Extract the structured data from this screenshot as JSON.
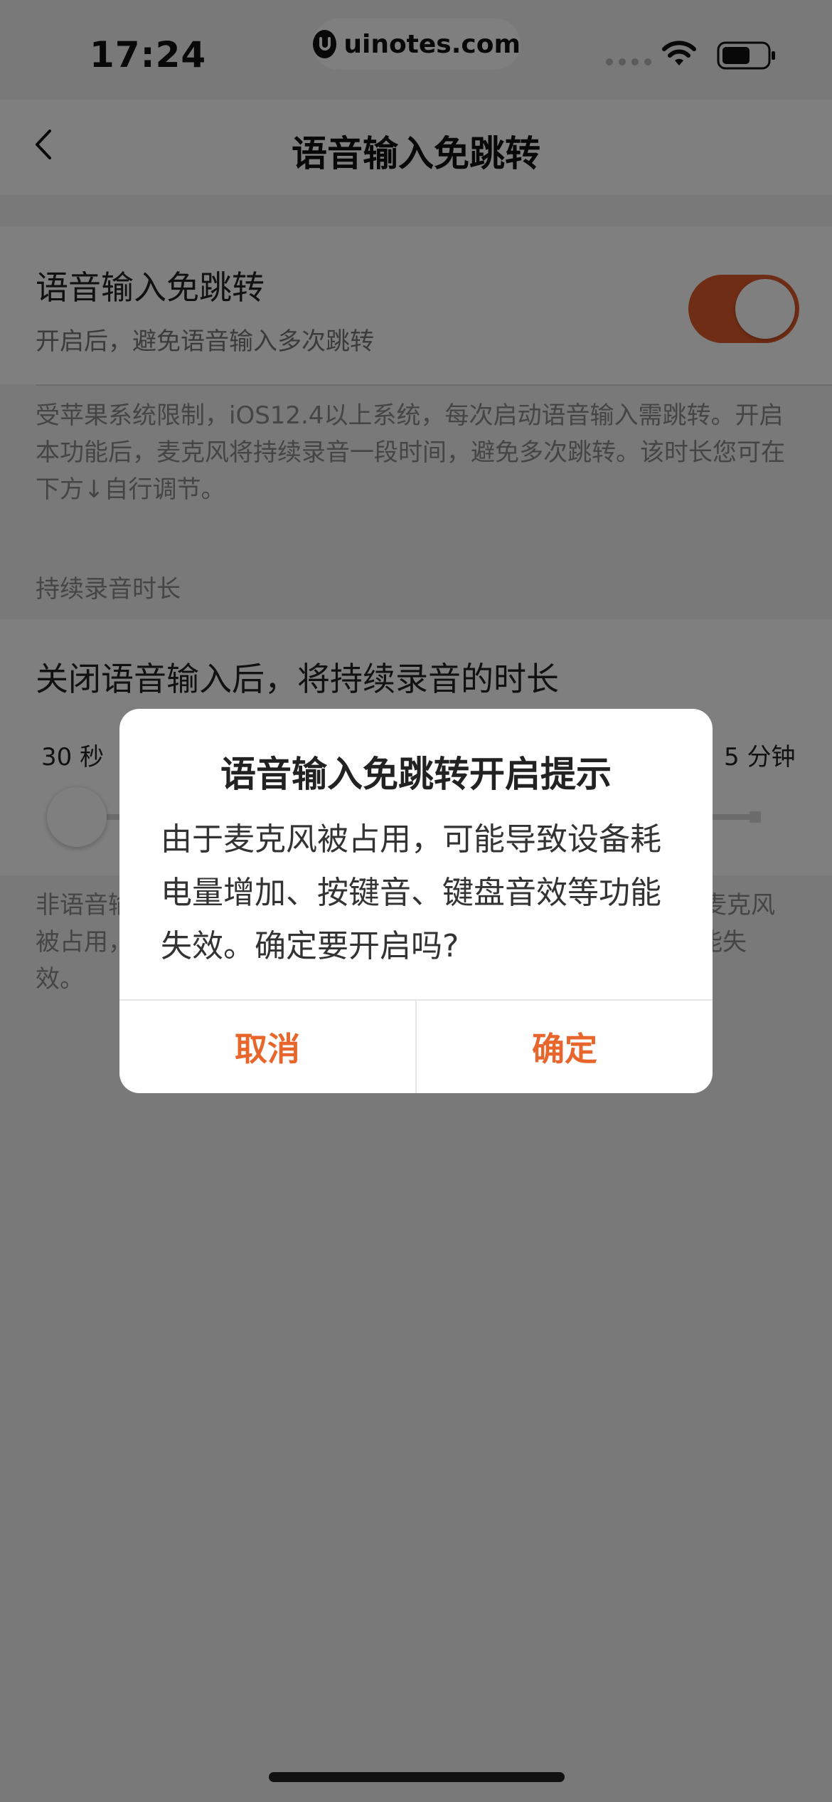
{
  "status_bar": {
    "time": "17:24",
    "watermark": "uinotes.com",
    "icons": [
      "signal-icon",
      "wifi-icon",
      "battery-icon"
    ]
  },
  "nav": {
    "title": "语音输入免跳转",
    "back_icon": "chevron-left-icon"
  },
  "toggle_cell": {
    "title": "语音输入免跳转",
    "subtitle": "开启后，避免语音输入多次跳转",
    "enabled": true,
    "accent_color": "#e05a2a"
  },
  "description": "受苹果系统限制，iOS12.4以上系统，每次启动语音输入需跳转。开启本功能后，麦克风将持续录音一段时间，避免多次跳转。该时长您可在下方↓自行调节。",
  "section_label": "持续录音时长",
  "duration_cell": {
    "title": "关闭语音输入后，将持续录音的时长",
    "min_label": "30 秒",
    "max_label": "5 分钟"
  },
  "note": {
    "line1_left": "非语音输",
    "line1_right": "麦克风",
    "line2_left": "被占用，",
    "line2_right": "能失",
    "line3": "效。"
  },
  "modal": {
    "title": "语音输入免跳转开启提示",
    "body": "由于麦克风被占用，可能导致设备耗电量增加、按键音、键盘音效等功能失效。确定要开启吗?",
    "cancel_label": "取消",
    "confirm_label": "确定",
    "button_color": "#e8652b"
  }
}
